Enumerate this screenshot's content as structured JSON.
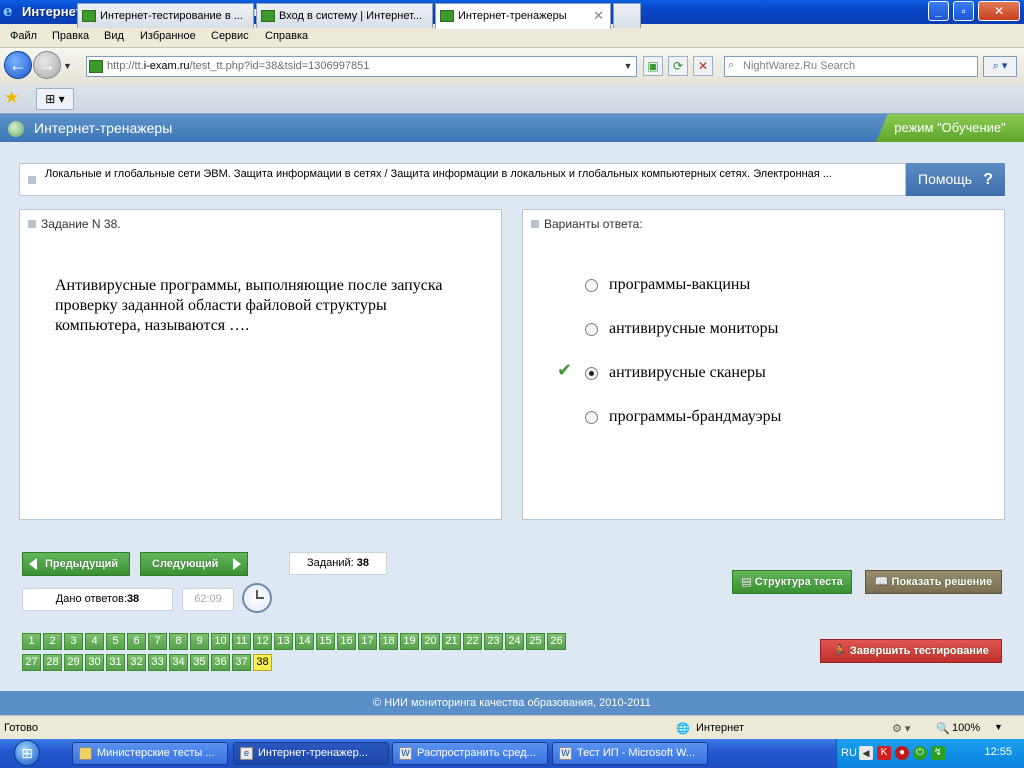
{
  "window": {
    "title": "Интернет-тренажеры - Windows Internet Explorer",
    "minimize": "0",
    "maximize": "1",
    "close": "✕"
  },
  "menu": [
    "Файл",
    "Правка",
    "Вид",
    "Избранное",
    "Сервис",
    "Справка"
  ],
  "address": {
    "prefix": "http://tt.",
    "host": "i-exam.ru",
    "path": "/test_tt.php?id=38&tsid=1306997851"
  },
  "search": {
    "placeholder": "NightWarez.Ru Search"
  },
  "tabs": [
    {
      "label": "Интернет-тестирование в ...",
      "active": false
    },
    {
      "label": "Вход в систему | Интернет...",
      "active": false
    },
    {
      "label": "Интернет-тренажеры",
      "active": true
    }
  ],
  "app": {
    "title": "Интернет-тренажеры",
    "mode": "режим \"Обучение\""
  },
  "breadcrumb": "Локальные и глобальные сети ЭВМ. Защита информации в сетях / Защита информации в локальных и глобальных компьютерных сетях. Электронная ...",
  "help": {
    "label": "Помощь",
    "q": "?"
  },
  "task": {
    "header": "Задание N 38.",
    "question": "Антивирусные программы, выполняющие после запуска проверку заданной области файловой структуры компьютера, называются …."
  },
  "answers": {
    "header": "Варианты ответа:",
    "options": [
      {
        "label": "программы-вакцины",
        "selected": false
      },
      {
        "label": "антивирусные мониторы",
        "selected": false
      },
      {
        "label": "антивирусные сканеры",
        "selected": true
      },
      {
        "label": "программы-брандмауэры",
        "selected": false
      }
    ],
    "check": "✔"
  },
  "controls": {
    "prev": "Предыдущий",
    "next": "Следующий",
    "tasks_label": "Заданий:",
    "tasks_count": "38",
    "answered_label": "Дано ответов:",
    "answered_count": "38",
    "timer": "62:09",
    "structure": "Структура теста",
    "show_solution": "Показать решение",
    "finish": "Завершить тестирование"
  },
  "question_numbers": {
    "row1": [
      "1",
      "2",
      "3",
      "4",
      "5",
      "6",
      "7",
      "8",
      "9",
      "10",
      "11",
      "12",
      "13",
      "14",
      "15",
      "16",
      "17",
      "18",
      "19",
      "20",
      "21",
      "22",
      "23",
      "24",
      "25",
      "26"
    ],
    "row2": [
      "27",
      "28",
      "29",
      "30",
      "31",
      "32",
      "33",
      "34",
      "35",
      "36",
      "37",
      "38"
    ],
    "current": "38"
  },
  "footer": "© НИИ мониторинга качества образования, 2010-2011",
  "status": {
    "left": "Готово",
    "zone": "Интернет",
    "zoom": "100%"
  },
  "taskbar": {
    "items": [
      {
        "label": "Министерские тесты ...",
        "icon": "folder-icon",
        "active": false
      },
      {
        "label": "Интернет-тренажер...",
        "icon": "ie-icon",
        "active": true
      },
      {
        "label": "Распространить сред...",
        "icon": "word-icon",
        "active": false
      },
      {
        "label": "Тест ИП - Microsoft W...",
        "icon": "word-icon",
        "active": false
      }
    ],
    "lang": "RU",
    "clock": "12:55"
  },
  "colors": {
    "accent_blue": "#3d77b6",
    "green": "#55a14a",
    "current_num": "#f7ef50",
    "finish_red": "#c2302d"
  }
}
